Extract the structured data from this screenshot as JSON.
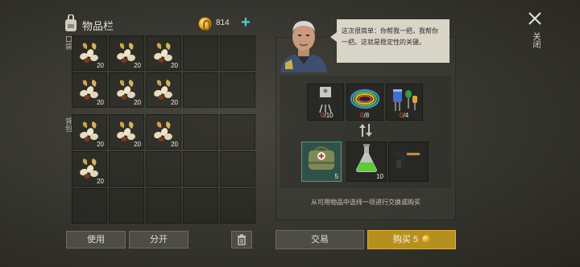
{
  "inventory": {
    "title": "物品栏",
    "coin_count": "814",
    "add_label": "+",
    "pocket_label": "口袋",
    "backpack_label": "背包",
    "pocket_slots": [
      {
        "item": "seeds",
        "qty": "20"
      },
      {
        "item": "seeds",
        "qty": "20"
      },
      {
        "item": "seeds",
        "qty": "20"
      },
      {
        "item": "",
        "qty": ""
      },
      {
        "item": "",
        "qty": ""
      },
      {
        "item": "seeds",
        "qty": "20"
      },
      {
        "item": "seeds",
        "qty": "20"
      },
      {
        "item": "seeds",
        "qty": "20"
      },
      {
        "item": "",
        "qty": ""
      },
      {
        "item": "",
        "qty": ""
      }
    ],
    "backpack_slots": [
      {
        "item": "seeds",
        "qty": "20"
      },
      {
        "item": "seeds",
        "qty": "20"
      },
      {
        "item": "seeds",
        "qty": "20"
      },
      {
        "item": "",
        "qty": ""
      },
      {
        "item": "",
        "qty": ""
      },
      {
        "item": "seeds",
        "qty": "20"
      },
      {
        "item": "",
        "qty": ""
      },
      {
        "item": "",
        "qty": ""
      },
      {
        "item": "",
        "qty": ""
      },
      {
        "item": "",
        "qty": ""
      },
      {
        "item": "",
        "qty": ""
      },
      {
        "item": "",
        "qty": ""
      },
      {
        "item": "",
        "qty": ""
      },
      {
        "item": "",
        "qty": ""
      },
      {
        "item": "",
        "qty": ""
      }
    ]
  },
  "buttons": {
    "use": "使用",
    "split": "分开",
    "trade": "交易",
    "buy": "购买",
    "buy_price": "5"
  },
  "trader": {
    "dialog": "这次很简单：你帮我一把，我帮你一把。这就是稳定性的关键。",
    "requirements": [
      {
        "icon": "transistor-icon",
        "have": "0",
        "need": "10"
      },
      {
        "icon": "wire-coil-icon",
        "have": "0",
        "need": "8"
      },
      {
        "icon": "capacitor-icon",
        "have": "0",
        "need": "4"
      }
    ],
    "offers": [
      {
        "icon": "first-aid-bag-icon",
        "qty": "5"
      },
      {
        "icon": "chemical-flask-icon",
        "qty": "10"
      },
      {
        "icon": "pistol-icon",
        "qty": ""
      }
    ],
    "hint": "从可用物品中选择一项进行交换或购买"
  },
  "close_label": "关闭",
  "colors": {
    "buy_button": "#b5901f",
    "selected_slot": "#2f5248",
    "accent_plus": "#4fd1c5",
    "missing_count": "#e05040"
  }
}
